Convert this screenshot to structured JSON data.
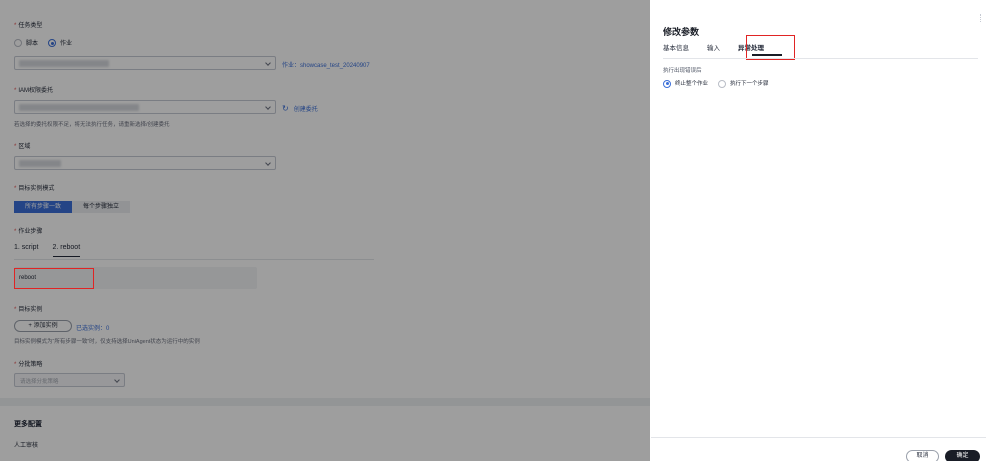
{
  "form": {
    "task_type": {
      "label": "任务类型",
      "options": [
        "脚本",
        "作业"
      ],
      "selected": "作业"
    },
    "job_link": "作业：showcase_test_20240907",
    "iam": {
      "label": "IAM权限委托",
      "create_link": "创建委托",
      "hint": "若选择的委托权限不足，将无法执行任务，请重新选择/创建委托"
    },
    "region": {
      "label": "区域"
    },
    "instance_mode": {
      "label": "目标实例模式",
      "options": [
        "所有步骤一致",
        "每个步骤独立"
      ],
      "selected": "所有步骤一致"
    },
    "job_steps": {
      "label": "作业步骤",
      "tabs": [
        "1. script",
        "2. reboot"
      ],
      "active_tab": "2. reboot",
      "step_name": "reboot"
    },
    "target_instances": {
      "label": "目标实例",
      "add_button": "+ 添加实例",
      "selected_count": "已选实例：0",
      "hint": "目标实例模式为“所有步骤一致”时，仅支持选择UniAgent状态为运行中的实例"
    },
    "batch_strategy": {
      "label": "分批策略",
      "placeholder": "请选择分批策略"
    },
    "more_config": {
      "title": "更多配置",
      "manual_review": "人工审核"
    }
  },
  "panel": {
    "title": "修改参数",
    "tabs": [
      "基本信息",
      "输入",
      "异常处理"
    ],
    "active_tab": "异常处理",
    "on_error_label": "执行出现错误后",
    "on_error_options": [
      "终止整个作业",
      "执行下一个步骤"
    ],
    "on_error_selected": "终止整个作业",
    "cancel": "取消",
    "ok": "确定"
  },
  "colors": {
    "accent": "#3b6fd8",
    "highlight": "#e02424",
    "primary_button": "#191d26"
  }
}
